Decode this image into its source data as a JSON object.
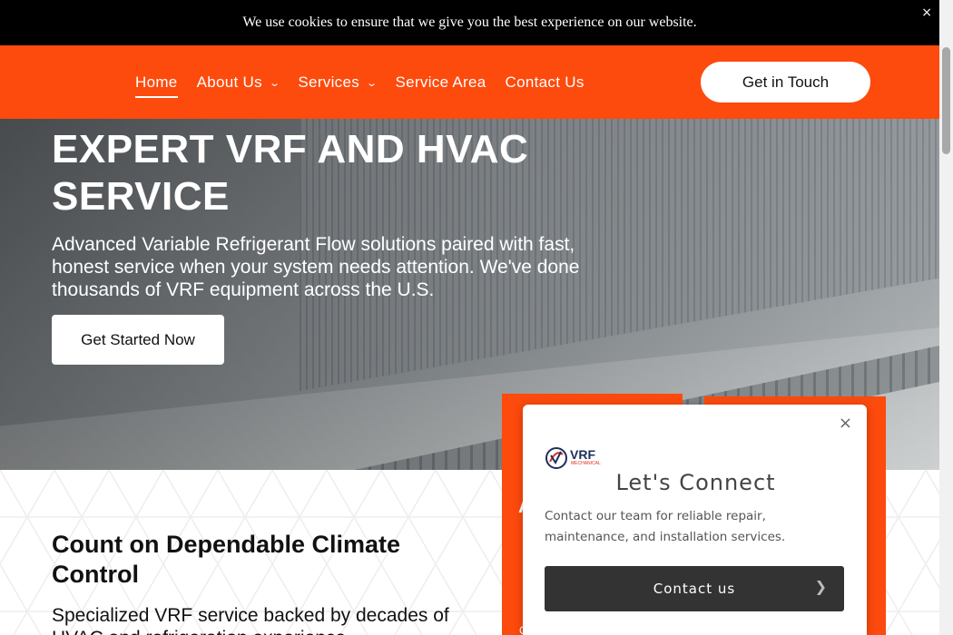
{
  "cookie_bar": {
    "text": "We use cookies to ensure that we give you the best experience on our website.",
    "close_glyph": "×"
  },
  "nav": {
    "items": [
      {
        "label": "Home",
        "active": true,
        "dropdown": false
      },
      {
        "label": "About Us",
        "active": false,
        "dropdown": true
      },
      {
        "label": "Services",
        "active": false,
        "dropdown": true
      },
      {
        "label": "Service Area",
        "active": false,
        "dropdown": false
      },
      {
        "label": "Contact Us",
        "active": false,
        "dropdown": false
      }
    ],
    "cta_label": "Get in Touch"
  },
  "hero": {
    "title": "EXPERT VRF AND HVAC SERVICE",
    "subtitle": "Advanced Variable Refrigerant Flow solutions paired with fast, honest service when your system needs attention. We've done thousands of VRF equipment across the U.S.",
    "button_label": "Get Started Now"
  },
  "section": {
    "title": "Count on Dependable Climate Control",
    "subtitle": "Specialized VRF service backed by decades of HVAC and refrigeration experience."
  },
  "popup": {
    "logo_text": "VRF",
    "logo_subtext": "MECHANICAL",
    "title": "Let's Connect",
    "text": "Contact our team for reliable repair, maintenance, and installation services.",
    "button_label": "Contact us",
    "close_glyph": "×",
    "button_arrow": "❯"
  },
  "card_fragments": {
    "a": "A",
    "b": "C"
  },
  "colors": {
    "brand_orange": "#fd4a0d",
    "dark_button": "#333333",
    "cookie_bar": "#000000"
  }
}
